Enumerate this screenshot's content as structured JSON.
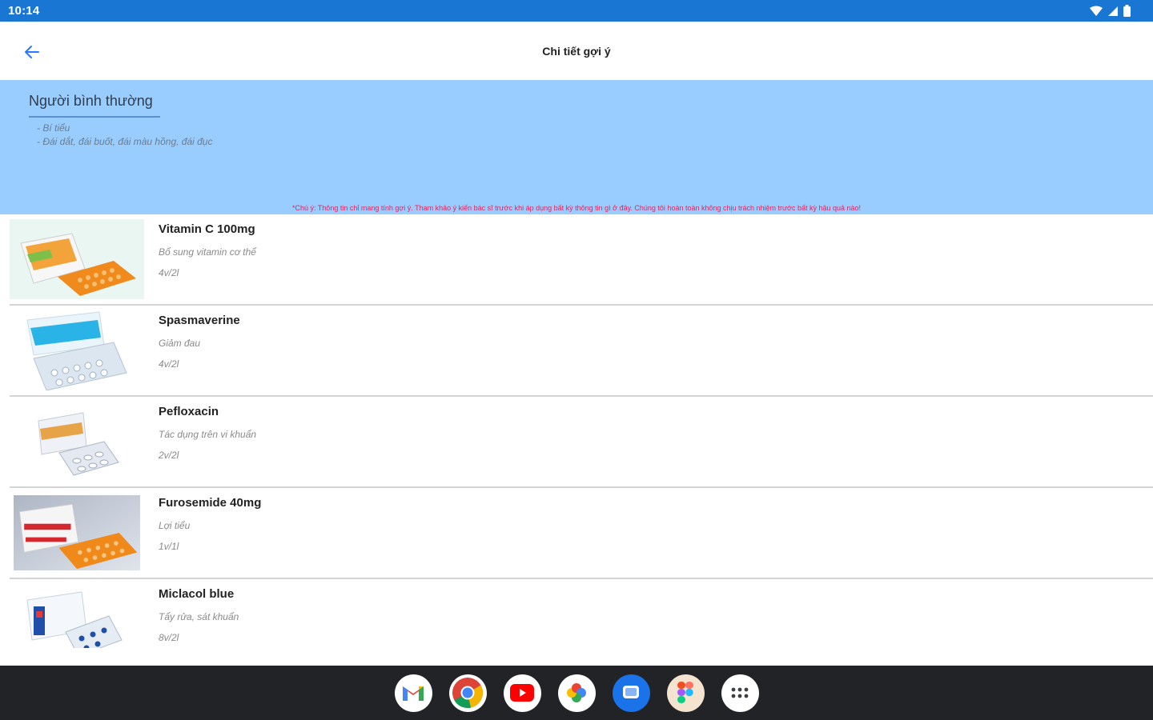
{
  "status_bar": {
    "time": "10:14"
  },
  "app_bar": {
    "title": "Chi tiết gợi ý"
  },
  "condition": {
    "title": "Người bình thường",
    "symptoms": [
      "- Bí tiểu",
      "- Đái dắt, đái buốt, đái màu hồng, đái đục"
    ],
    "disclaimer": "*Chú ý: Thông tin chỉ mang tính gợi ý. Tham khảo ý kiến bác sĩ trước khi áp dụng bất kỳ thông tin gì ở đây. Chúng tôi hoàn toàn không chịu trách nhiệm trước bất kỳ hậu quả nào!"
  },
  "medicines": [
    {
      "name": "Vitamin C 100mg",
      "description": "Bổ sung vitamin cơ thể",
      "dose": "4v/2l"
    },
    {
      "name": "Spasmaverine",
      "description": "Giảm đau",
      "dose": "4v/2l"
    },
    {
      "name": "Pefloxacin",
      "description": "Tác dụng trên vi khuẩn",
      "dose": "2v/2l"
    },
    {
      "name": "Furosemide 40mg",
      "description": "Lợi tiểu",
      "dose": "1v/1l"
    },
    {
      "name": "Miclacol blue",
      "description": "Tẩy rửa, sát khuẩn",
      "dose": "8v/2l"
    }
  ],
  "taskbar": {
    "apps": [
      "gmail-icon",
      "chrome-icon",
      "youtube-icon",
      "photos-icon",
      "messages-icon",
      "figma-icon",
      "app-launcher-icon"
    ]
  },
  "colors": {
    "status_bar": "#1976D2",
    "condition_bg": "#99CCFF",
    "disclaimer": "#e0245e",
    "accent": "#2979FF",
    "taskbar": "#222326"
  }
}
